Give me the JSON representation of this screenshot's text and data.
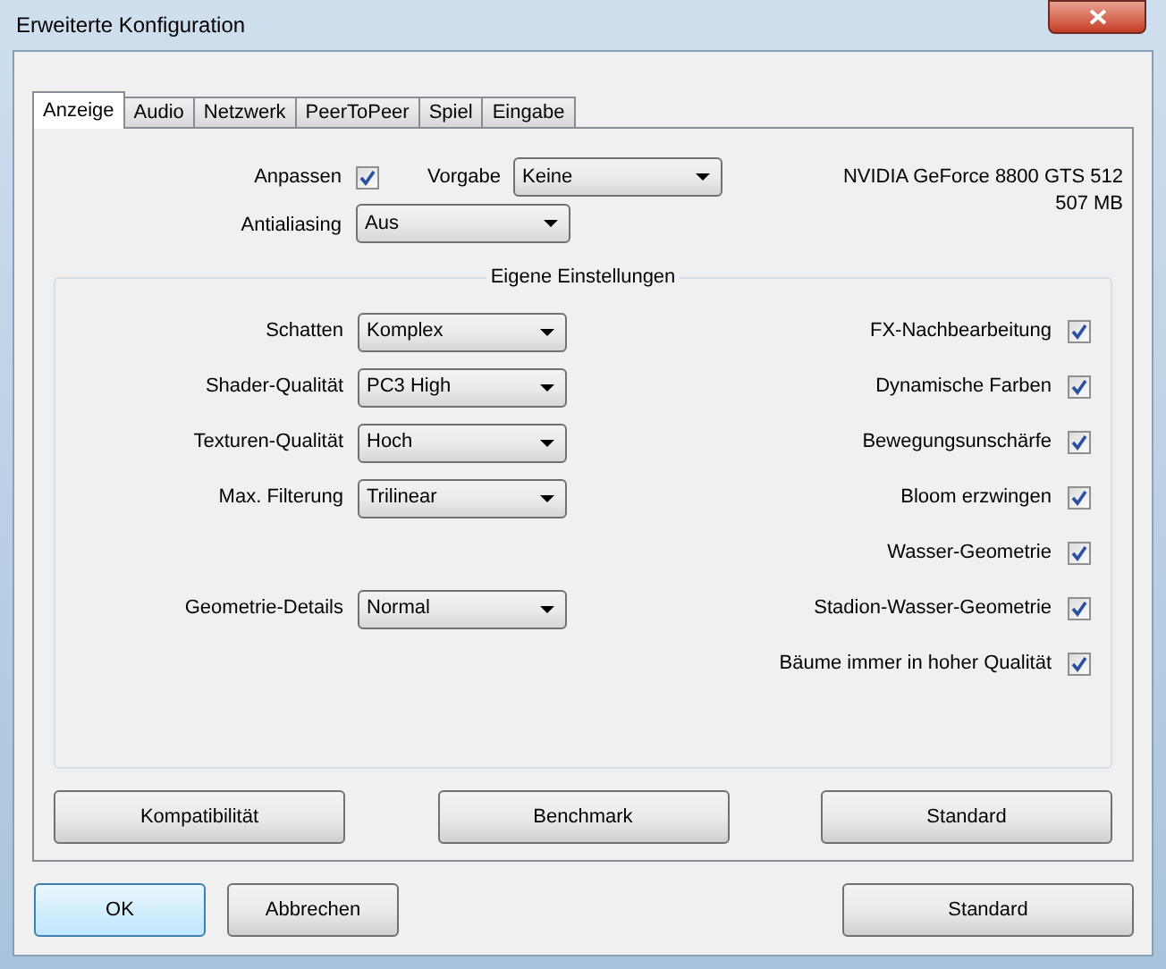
{
  "window": {
    "title": "Erweiterte Konfiguration"
  },
  "tabs": [
    {
      "label": "Anzeige",
      "selected": true
    },
    {
      "label": "Audio",
      "selected": false
    },
    {
      "label": "Netzwerk",
      "selected": false
    },
    {
      "label": "PeerToPeer",
      "selected": false
    },
    {
      "label": "Spiel",
      "selected": false
    },
    {
      "label": "Eingabe",
      "selected": false
    }
  ],
  "top": {
    "adjust": {
      "label": "Anpassen",
      "checked": true
    },
    "preset": {
      "label": "Vorgabe",
      "value": "Keine"
    },
    "antialiasing": {
      "label": "Antialiasing",
      "value": "Aus"
    },
    "gpu": "NVIDIA GeForce 8800 GTS 512",
    "memory": "507 MB"
  },
  "custom": {
    "title": "Eigene Einstellungen",
    "rows": [
      {
        "combo": {
          "label": "Schatten",
          "value": "Komplex"
        },
        "checkbox": {
          "label": "FX-Nachbearbeitung",
          "checked": true
        }
      },
      {
        "combo": {
          "label": "Shader-Qualität",
          "value": "PC3 High"
        },
        "checkbox": {
          "label": "Dynamische Farben",
          "checked": true
        }
      },
      {
        "combo": {
          "label": "Texturen-Qualität",
          "value": "Hoch"
        },
        "checkbox": {
          "label": "Bewegungsunschärfe",
          "checked": true
        }
      },
      {
        "combo": {
          "label": "Max. Filterung",
          "value": "Trilinear"
        },
        "checkbox": {
          "label": "Bloom erzwingen",
          "checked": true
        }
      },
      {
        "checkbox": {
          "label": "Wasser-Geometrie",
          "checked": true
        }
      },
      {
        "combo": {
          "label": "Geometrie-Details",
          "value": "Normal"
        },
        "checkbox": {
          "label": "Stadion-Wasser-Geometrie",
          "checked": true
        }
      },
      {
        "checkbox": {
          "label": "Bäume immer in hoher Qualität",
          "checked": true
        }
      }
    ]
  },
  "panel_buttons": [
    "Kompatibilität",
    "Benchmark",
    "Standard"
  ],
  "dialog_buttons": [
    {
      "label": "OK",
      "default": true
    },
    {
      "label": "Abbrechen",
      "default": false
    },
    {
      "label": "Standard",
      "default": false
    }
  ]
}
